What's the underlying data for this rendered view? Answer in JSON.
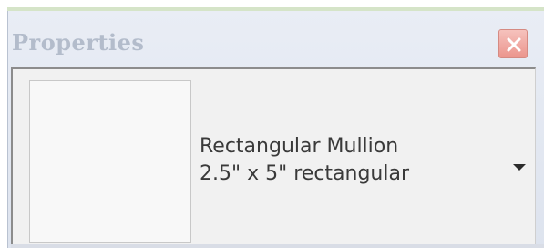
{
  "panel": {
    "title": "Properties",
    "close_icon": "close-icon",
    "accent_close": "#ee9a92"
  },
  "type_selector": {
    "family": "Rectangular Mullion",
    "type": "2.5\" x 5\" rectangular",
    "dropdown_icon": "chevron-down-icon"
  }
}
